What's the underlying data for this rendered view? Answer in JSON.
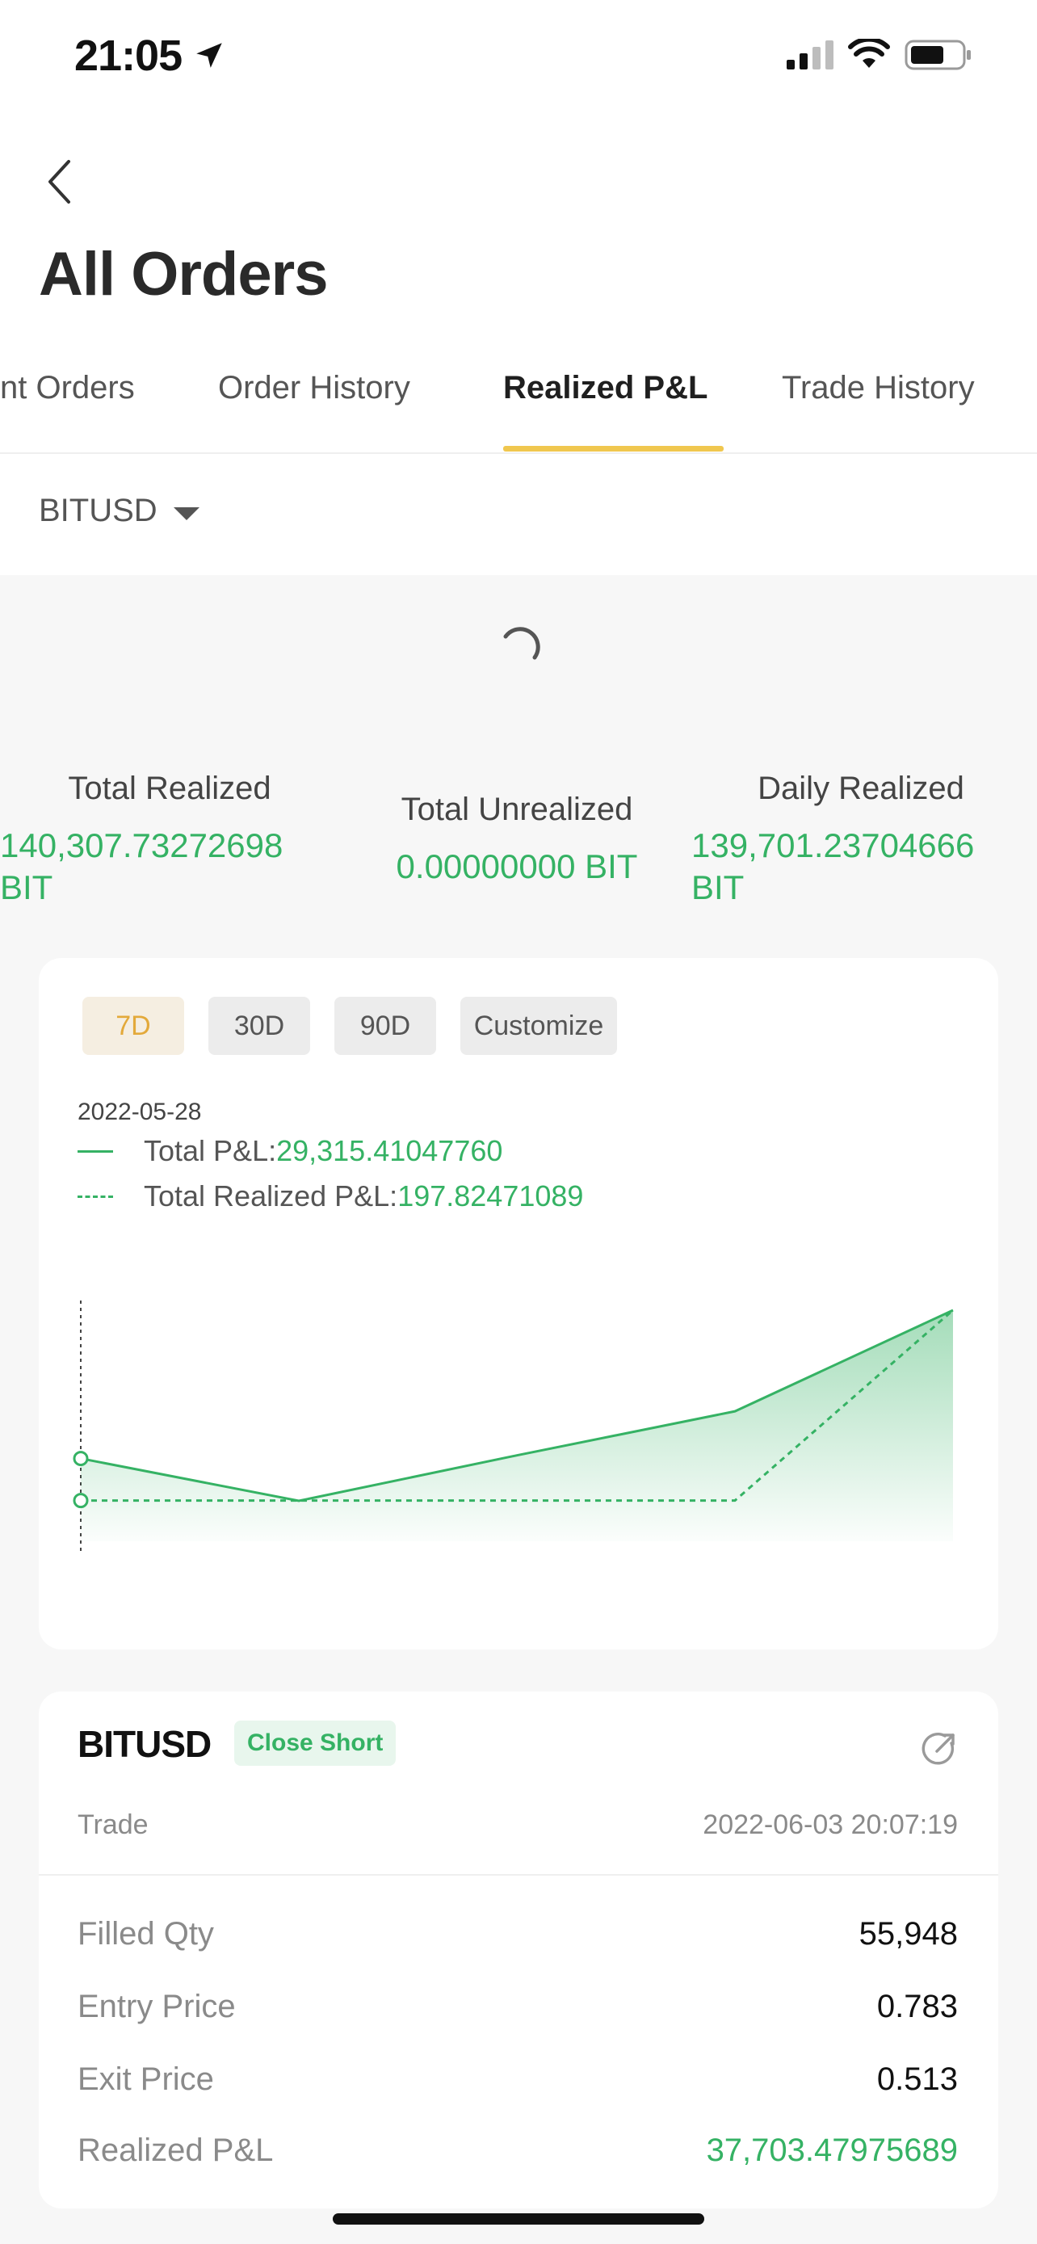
{
  "status_bar": {
    "time": "21:05"
  },
  "nav": {
    "title": "All Orders"
  },
  "tabs": [
    {
      "label": "nt Orders"
    },
    {
      "label": "Order History"
    },
    {
      "label": "Realized P&L"
    },
    {
      "label": "Trade History"
    }
  ],
  "filter": {
    "symbol": "BITUSD"
  },
  "summary": {
    "total_realized_label": "Total Realized",
    "total_realized_value": "140,307.73272698",
    "total_realized_unit": "BIT",
    "total_unrealized_label": "Total Unrealized",
    "total_unrealized_value": "0.00000000 BIT",
    "daily_realized_label": "Daily Realized",
    "daily_realized_value": "139,701.23704666",
    "daily_realized_unit": "BIT"
  },
  "ranges": [
    "7D",
    "30D",
    "90D",
    "Customize"
  ],
  "chart_header": {
    "date": "2022-05-28",
    "legend": [
      {
        "label": "Total P&L:",
        "value": "29,315.41047760",
        "style": "solid"
      },
      {
        "label": "Total Realized P&L:",
        "value": "197.82471089",
        "style": "dashed"
      }
    ]
  },
  "chart_data": {
    "type": "area",
    "series": [
      {
        "values": [
          29315.41,
          0,
          31500,
          62000,
          132000
        ],
        "style": "solid",
        "fill": "area"
      },
      {
        "values": [
          197.82,
          197.82,
          197.82,
          197.82,
          132000
        ],
        "style": "dashed"
      }
    ],
    "grid": false,
    "color": "#35b264"
  },
  "order": {
    "symbol": "BITUSD",
    "badge": "Close Short",
    "type": "Trade",
    "time": "2022-06-03 20:07:19",
    "details": [
      {
        "label": "Filled Qty",
        "value": "55,948"
      },
      {
        "label": "Entry Price",
        "value": "0.783"
      },
      {
        "label": "Exit Price",
        "value": "0.513"
      },
      {
        "label": "Realized P&L",
        "value": "37,703.47975689"
      }
    ]
  },
  "colors": {
    "accent_green": "#35b264",
    "tab_underline": "#f0c74f",
    "active_range": "#e3a93a"
  }
}
